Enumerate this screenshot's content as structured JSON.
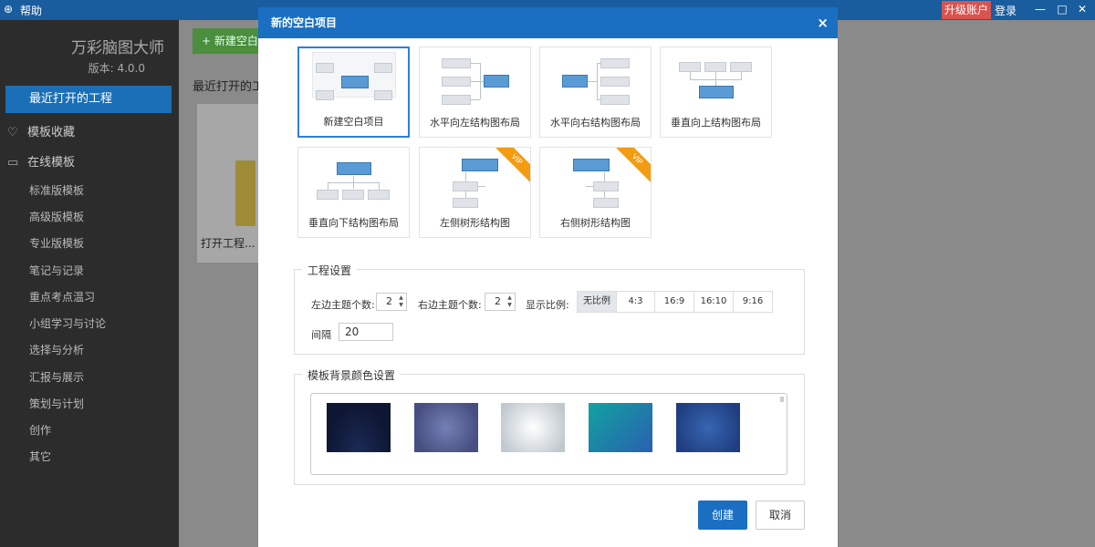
{
  "app": {
    "help": "帮助",
    "upgrade": "升级账户",
    "login": "登录",
    "brand": "万彩脑图大师",
    "version": "版本: 4.0.0"
  },
  "sidebar": {
    "recent": "最近打开的工程",
    "favorites": "模板收藏",
    "online": "在线模板",
    "items": [
      {
        "label": "标准版模板"
      },
      {
        "label": "高级版模板"
      },
      {
        "label": "专业版模板"
      },
      {
        "label": "笔记与记录"
      },
      {
        "label": "重点考点温习"
      },
      {
        "label": "小组学习与讨论"
      },
      {
        "label": "选择与分析"
      },
      {
        "label": "汇报与展示"
      },
      {
        "label": "策划与计划"
      },
      {
        "label": "创作"
      },
      {
        "label": "其它"
      }
    ]
  },
  "content": {
    "new_button": "+ 新建空白",
    "recent_title": "最近打开的工",
    "open_card": "打开工程..."
  },
  "dialog": {
    "title": "新的空白项目",
    "close_icon": "×",
    "templates": [
      {
        "label": "新建空白项目",
        "vip": false,
        "selected": true
      },
      {
        "label": "水平向左结构图布局",
        "vip": false,
        "selected": false
      },
      {
        "label": "水平向右结构图布局",
        "vip": false,
        "selected": false
      },
      {
        "label": "垂直向上结构图布局",
        "vip": false,
        "selected": false
      },
      {
        "label": "垂直向下结构图布局",
        "vip": false,
        "selected": false
      },
      {
        "label": "左侧树形结构图",
        "vip": true,
        "selected": false
      },
      {
        "label": "右侧树形结构图",
        "vip": true,
        "selected": false
      }
    ],
    "vip_badge": "VIP",
    "project_settings": {
      "legend": "工程设置",
      "left_topics_label": "左边主题个数:",
      "left_topics_value": "2",
      "right_topics_label": "右边主题个数:",
      "right_topics_value": "2",
      "ratio_label": "显示比例:",
      "ratios": [
        "无比例",
        "4:3",
        "16:9",
        "16:10",
        "9:16"
      ],
      "active_ratio": "无比例",
      "gap_label": "间隔",
      "gap_value": "20"
    },
    "background_settings": {
      "legend": "模板背景颜色设置",
      "swatches": [
        {
          "name": "dark-navy",
          "color": "#17244a"
        },
        {
          "name": "purple-blue-radial",
          "color": "#5a6699"
        },
        {
          "name": "light-gray-radial",
          "color": "#dfe3e6"
        },
        {
          "name": "teal-blue",
          "color": "#1e8e9a"
        },
        {
          "name": "royal-blue",
          "color": "#2a4f96"
        }
      ]
    },
    "create_button": "创建",
    "cancel_button": "取消"
  },
  "colors": {
    "accent": "#1a6fc2",
    "topbar": "#1a5d9e",
    "sidebar_bg": "#2c2c2c",
    "upgrade": "#d9534f",
    "vip": "#f39c12"
  }
}
